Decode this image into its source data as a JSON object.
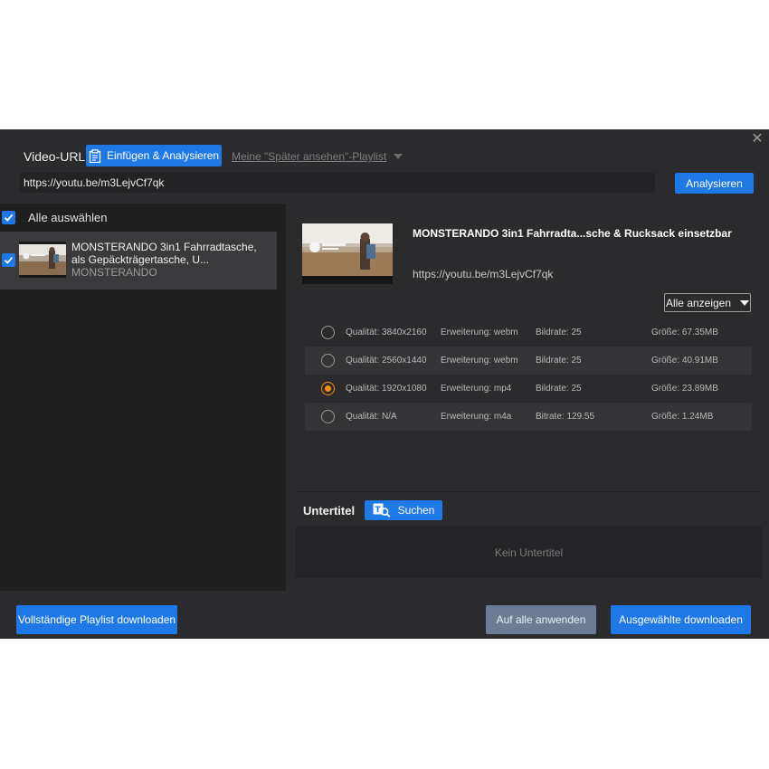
{
  "header": {
    "url_label": "Video-URL",
    "paste_analyze_label": "Einfügen & Analysieren",
    "watch_later_label": "Meine \"Später ansehen\"-Playlist",
    "url_value": "https://youtu.be/m3LejvCf7qk",
    "analyze_label": "Analysieren"
  },
  "sidebar": {
    "select_all_label": "Alle auswählen",
    "items": [
      {
        "title": "MONSTERANDO 3in1 Fahrradtasche, als Gepäckträgertasche, U...",
        "channel": "MONSTERANDO",
        "checked": true
      }
    ]
  },
  "detail": {
    "title": "MONSTERANDO 3in1 Fahrradta...sche & Rucksack einsetzbar",
    "url": "https://youtu.be/m3LejvCf7qk",
    "filter_label": "Alle anzeigen",
    "formats": [
      {
        "quality": "Qualität: 3840x2160",
        "ext": "Erweiterung: webm",
        "rate": "Bildrate: 25",
        "size": "Größe: 67.35MB",
        "selected": false
      },
      {
        "quality": "Qualität: 2560x1440",
        "ext": "Erweiterung: webm",
        "rate": "Bildrate: 25",
        "size": "Größe: 40.91MB",
        "selected": false
      },
      {
        "quality": "Qualität: 1920x1080",
        "ext": "Erweiterung: mp4",
        "rate": "Bildrate: 25",
        "size": "Größe: 23.89MB",
        "selected": true
      },
      {
        "quality": "Qualität: N/A",
        "ext": "Erweiterung: m4a",
        "rate": "Bitrate: 129.55",
        "size": "Größe: 1.24MB",
        "selected": false
      }
    ],
    "subtitle_label": "Untertitel",
    "subtitle_search_label": "Suchen",
    "subtitle_empty": "Kein Untertitel"
  },
  "footer": {
    "playlist_label": "Vollständige Playlist downloaden",
    "apply_all_label": "Auf alle anwenden",
    "download_selected_label": "Ausgewählte downloaden"
  },
  "colors": {
    "accent": "#1e79e6",
    "selected_radio": "#f28c1c",
    "dialog_bg": "#2b2b2d",
    "sidebar_bg": "#1f1f1f"
  }
}
